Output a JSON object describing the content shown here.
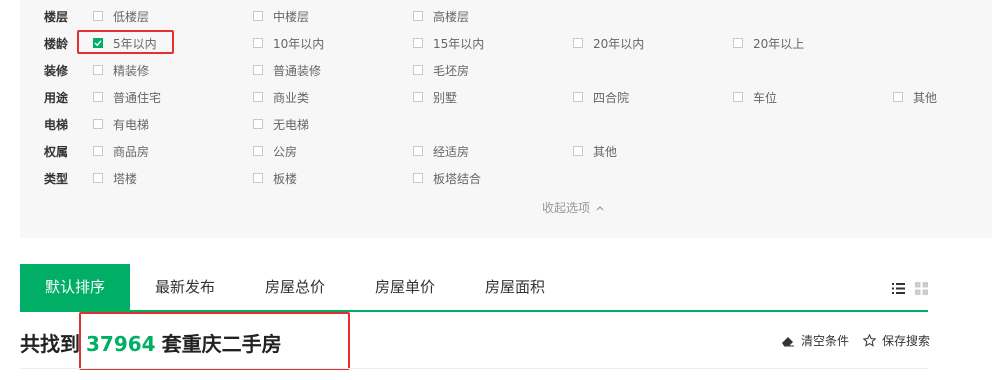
{
  "filters": [
    {
      "label": "楼层",
      "options": [
        {
          "text": "低楼层",
          "checked": false
        },
        {
          "text": "中楼层",
          "checked": false
        },
        {
          "text": "高楼层",
          "checked": false
        }
      ]
    },
    {
      "label": "楼龄",
      "options": [
        {
          "text": "5年以内",
          "checked": true
        },
        {
          "text": "10年以内",
          "checked": false
        },
        {
          "text": "15年以内",
          "checked": false
        },
        {
          "text": "20年以内",
          "checked": false
        },
        {
          "text": "20年以上",
          "checked": false
        }
      ]
    },
    {
      "label": "装修",
      "options": [
        {
          "text": "精装修",
          "checked": false
        },
        {
          "text": "普通装修",
          "checked": false
        },
        {
          "text": "毛坯房",
          "checked": false
        }
      ]
    },
    {
      "label": "用途",
      "options": [
        {
          "text": "普通住宅",
          "checked": false
        },
        {
          "text": "商业类",
          "checked": false
        },
        {
          "text": "别墅",
          "checked": false
        },
        {
          "text": "四合院",
          "checked": false
        },
        {
          "text": "车位",
          "checked": false
        },
        {
          "text": "其他",
          "checked": false
        }
      ]
    },
    {
      "label": "电梯",
      "options": [
        {
          "text": "有电梯",
          "checked": false
        },
        {
          "text": "无电梯",
          "checked": false
        }
      ]
    },
    {
      "label": "权属",
      "options": [
        {
          "text": "商品房",
          "checked": false
        },
        {
          "text": "公房",
          "checked": false
        },
        {
          "text": "经适房",
          "checked": false
        },
        {
          "text": "其他",
          "checked": false
        }
      ]
    },
    {
      "label": "类型",
      "options": [
        {
          "text": "塔楼",
          "checked": false
        },
        {
          "text": "板楼",
          "checked": false
        },
        {
          "text": "板塔结合",
          "checked": false
        }
      ]
    }
  ],
  "collapse_label": "收起选项",
  "tabs": [
    "默认排序",
    "最新发布",
    "房屋总价",
    "房屋单价",
    "房屋面积"
  ],
  "active_tab": 0,
  "result": {
    "prefix": "共找到",
    "count": "37964",
    "suffix": "套重庆二手房"
  },
  "actions": {
    "clear": "清空条件",
    "save": "保存搜索"
  },
  "colors": {
    "accent": "#00ae66",
    "highlight": "#e53030"
  }
}
